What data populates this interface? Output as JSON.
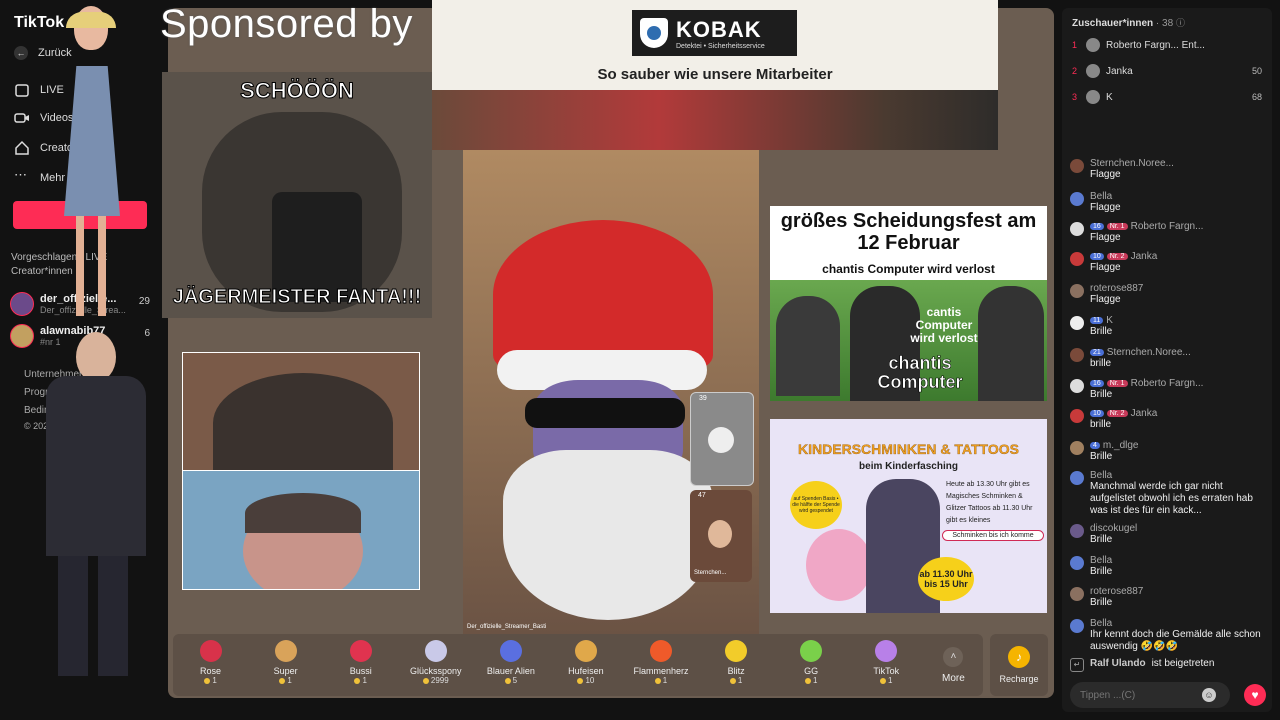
{
  "sidebar": {
    "logo": "TikTok",
    "back_label": "Zurück",
    "nav": [
      {
        "label": "LIVE",
        "icon": "calendar-icon"
      },
      {
        "label": "Videos",
        "icon": "video-icon"
      },
      {
        "label": "Creator-Tools",
        "icon": "home-icon"
      },
      {
        "label": "Mehr",
        "icon": "more-icon"
      }
    ],
    "suggested_title": "Vorgeschlagene LIVE Creator*innen",
    "users": [
      {
        "name": "der_offizielle...",
        "sub": "Der_offizielle_Strea...",
        "count": "29"
      },
      {
        "name": "alawnabib77",
        "sub": "#nr 1",
        "count": "6"
      }
    ],
    "footer": [
      "Unternehmen",
      "Programm",
      "Bedingungen",
      "© 2026 TikTok"
    ]
  },
  "stage": {
    "sponsor_text": "Sponsored by",
    "ad_brand": "KOBAK",
    "ad_brand_sub": "Detektei • Sicherheitsservice",
    "ad_slogan": "So sauber wie unsere Mitarbeiter",
    "meme_top": "SCHÖÖÖN",
    "meme_bottom": "JÄGERMEISTER FANTA!!!",
    "scheidung_title": "größes Scheidungsfest am 12 Februar",
    "scheidung_sub": "chantis Computer wird verlost",
    "scheidung_overlay": "cantis Computer wird verlost",
    "scheidung_big": "chantis Computer",
    "kinder_title": "KINDERSCHMINKEN & TATTOOS",
    "kinder_sub": "beim Kinderfasching",
    "kinder_note": "auf Spenden Basis • die hälfte der Spende wird gespendet",
    "kinder_text": "Heute ab 13.30 Uhr gibt es Magisches Schminken & Glitzer Tattoos ab 11.30 Uhr gibt es kleines",
    "kinder_highlight": "Schminken bis ich komme",
    "kinder_times": "ab 11.30 Uhr bis 15 Uhr",
    "streamer_caption": "Der_offizielle_Streamer_Basti",
    "guest1_count": "39",
    "guest2_count": "47",
    "guest2_name": "Sternchen..."
  },
  "gifts": [
    {
      "name": "Rose",
      "price": "1",
      "color": "#d8324a"
    },
    {
      "name": "Super",
      "price": "1",
      "color": "#d9a35a"
    },
    {
      "name": "Bussi",
      "price": "1",
      "color": "#e0334f"
    },
    {
      "name": "Glücksspony",
      "price": "2999",
      "color": "#c9c9e8"
    },
    {
      "name": "Blauer Alien",
      "price": "5",
      "color": "#5a6fe0"
    },
    {
      "name": "Hufeisen",
      "price": "10",
      "color": "#e0a84a"
    },
    {
      "name": "Flammenherz",
      "price": "1",
      "color": "#ef5a2a"
    },
    {
      "name": "Blitz",
      "price": "1",
      "color": "#f2cc2a"
    },
    {
      "name": "GG",
      "price": "1",
      "color": "#7ad04a"
    },
    {
      "name": "TikTok",
      "price": "1",
      "color": "#b880e8"
    }
  ],
  "more_label": "More",
  "recharge_label": "Recharge",
  "chat": {
    "header": "Zuschauer*innen",
    "viewer_count": "38",
    "ranking": [
      {
        "rank": "1",
        "name": "Roberto Fargn... Ent...",
        "score": ""
      },
      {
        "rank": "2",
        "name": "Janka",
        "score": "50"
      },
      {
        "rank": "3",
        "name": "K",
        "score": "68"
      }
    ],
    "messages": [
      {
        "user": "Sternchen.Noree...",
        "level": "",
        "text": "Flagge",
        "avatar": "#7a4a3a"
      },
      {
        "user": "Bella",
        "level": "",
        "text": "Flagge",
        "avatar": "#5a7ad0"
      },
      {
        "user": "Roberto Fargn...",
        "level": "16",
        "rank": "Nr. 1",
        "text": "Flagge",
        "avatar": "#ddd"
      },
      {
        "user": "Janka",
        "level": "10",
        "rank": "Nr. 2",
        "text": "Flagge",
        "avatar": "#c83a3a"
      },
      {
        "user": "roterose887",
        "level": "",
        "text": "Flagge",
        "avatar": "#8a7060"
      },
      {
        "user": "K",
        "level": "11",
        "text": "Brille",
        "avatar": "#eee"
      },
      {
        "user": "Sternchen.Noree...",
        "level": "21",
        "text": "brille",
        "avatar": "#7a4a3a"
      },
      {
        "user": "Roberto Fargn...",
        "level": "16",
        "rank": "Nr. 1",
        "text": "Brille",
        "avatar": "#ddd"
      },
      {
        "user": "Janka",
        "level": "10",
        "rank": "Nr. 2",
        "text": "brille",
        "avatar": "#c83a3a"
      },
      {
        "user": "m._dlge",
        "level": "4",
        "text": "Brille",
        "avatar": "#a08060"
      },
      {
        "user": "Bella",
        "level": "",
        "text": "Manchmal werde ich gar nicht aufgelistet obwohl ich es erraten hab was ist des für ein kack...",
        "avatar": "#5a7ad0"
      },
      {
        "user": "discokugel",
        "level": "",
        "text": "Brille",
        "avatar": "#6a5a8a"
      },
      {
        "user": "Bella",
        "level": "",
        "text": "Brille",
        "avatar": "#5a7ad0"
      },
      {
        "user": "roterose887",
        "level": "",
        "text": "Brille",
        "avatar": "#8a7060"
      },
      {
        "user": "Bella",
        "level": "",
        "text": "Ihr kennt doch die Gemälde alle schon auswendig 🤣🤣🤣",
        "avatar": "#5a7ad0"
      }
    ],
    "join_user": "Ralf Ulando",
    "join_text": "ist beigetreten",
    "input_placeholder": "Tippen ...(C)"
  }
}
